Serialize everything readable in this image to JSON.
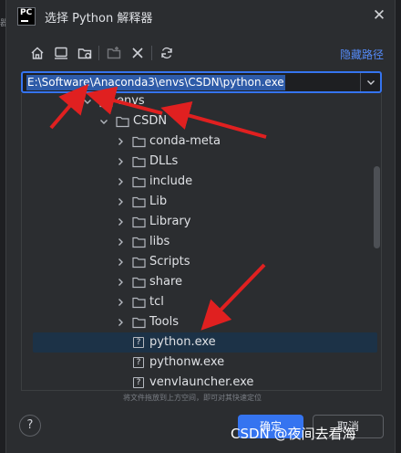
{
  "window": {
    "title": "选择 Python 解释器",
    "app_icon_text": "PC"
  },
  "edge_text": "器",
  "toolbar": {
    "buttons": [
      "home-icon",
      "desktop-icon",
      "new-folder-icon",
      "delete-icon",
      "close-icon",
      "refresh-icon"
    ],
    "hide_path_label": "隐藏路径"
  },
  "path_field": {
    "value": "E:\\Software\\Anaconda3\\envs\\CSDN\\python.exe"
  },
  "tree": {
    "items": [
      {
        "label": "envs",
        "type": "folder",
        "expanded": true,
        "depth": 0
      },
      {
        "label": "CSDN",
        "type": "folder",
        "expanded": true,
        "depth": 1
      },
      {
        "label": "conda-meta",
        "type": "folder",
        "expanded": false,
        "depth": 2
      },
      {
        "label": "DLLs",
        "type": "folder",
        "expanded": false,
        "depth": 2
      },
      {
        "label": "include",
        "type": "folder",
        "expanded": false,
        "depth": 2
      },
      {
        "label": "Lib",
        "type": "folder",
        "expanded": false,
        "depth": 2
      },
      {
        "label": "Library",
        "type": "folder",
        "expanded": false,
        "depth": 2
      },
      {
        "label": "libs",
        "type": "folder",
        "expanded": false,
        "depth": 2
      },
      {
        "label": "Scripts",
        "type": "folder",
        "expanded": false,
        "depth": 2
      },
      {
        "label": "share",
        "type": "folder",
        "expanded": false,
        "depth": 2
      },
      {
        "label": "tcl",
        "type": "folder",
        "expanded": false,
        "depth": 2
      },
      {
        "label": "Tools",
        "type": "folder",
        "expanded": false,
        "depth": 2
      },
      {
        "label": "python.exe",
        "type": "file",
        "selected": true,
        "depth": 2
      },
      {
        "label": "pythonw.exe",
        "type": "file",
        "depth": 2
      },
      {
        "label": "venvlauncher.exe",
        "type": "file",
        "depth": 2
      }
    ]
  },
  "hint": "将文件拖放到上方空间，即可对其快速定位",
  "buttons": {
    "help": "?",
    "ok": "确定",
    "cancel": "取消"
  },
  "watermark": "CSDN @夜间去看海",
  "colors": {
    "background": "#2b2d30",
    "accent": "#3574f0",
    "selection": "#1c3247",
    "link": "#548af7",
    "annotation": "#e02020"
  }
}
